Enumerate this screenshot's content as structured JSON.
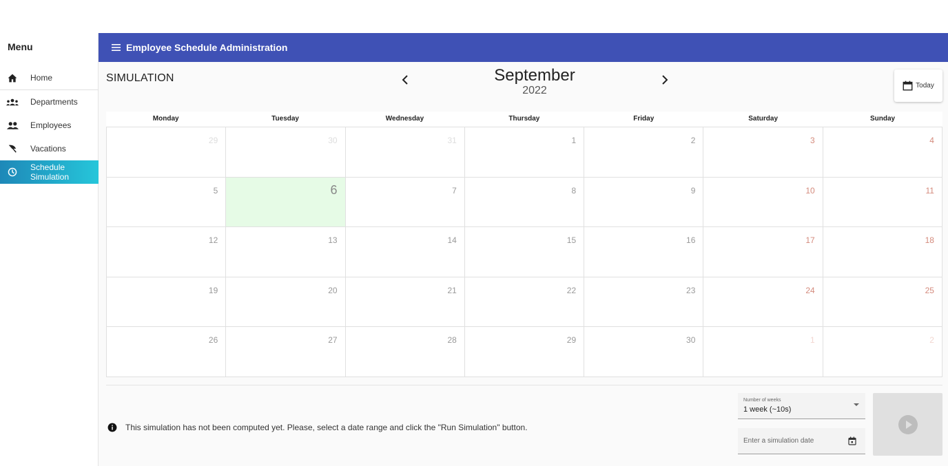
{
  "sidebar": {
    "title": "Menu",
    "items": [
      {
        "label": "Home",
        "icon": "home-icon"
      },
      {
        "label": "Departments",
        "icon": "groups-icon"
      },
      {
        "label": "Employees",
        "icon": "people-icon"
      },
      {
        "label": "Vacations",
        "icon": "beach-umbrella-icon"
      },
      {
        "label": "Schedule\nSimulation",
        "icon": "clock-icon",
        "active": true
      }
    ]
  },
  "header": {
    "title": "Employee Schedule Administration"
  },
  "main": {
    "section_label": "SIMULATION",
    "month": "September",
    "year": "2022",
    "today_label": "Today"
  },
  "calendar": {
    "weekdays": [
      "Monday",
      "Tuesday",
      "Wednesday",
      "Thursday",
      "Friday",
      "Saturday",
      "Sunday"
    ],
    "today": "6",
    "weeks": [
      [
        {
          "d": "29",
          "o": true
        },
        {
          "d": "30",
          "o": true
        },
        {
          "d": "31",
          "o": true
        },
        {
          "d": "1"
        },
        {
          "d": "2"
        },
        {
          "d": "3"
        },
        {
          "d": "4"
        }
      ],
      [
        {
          "d": "5"
        },
        {
          "d": "6",
          "t": true
        },
        {
          "d": "7"
        },
        {
          "d": "8"
        },
        {
          "d": "9"
        },
        {
          "d": "10"
        },
        {
          "d": "11"
        }
      ],
      [
        {
          "d": "12"
        },
        {
          "d": "13"
        },
        {
          "d": "14"
        },
        {
          "d": "15"
        },
        {
          "d": "16"
        },
        {
          "d": "17"
        },
        {
          "d": "18"
        }
      ],
      [
        {
          "d": "19"
        },
        {
          "d": "20"
        },
        {
          "d": "21"
        },
        {
          "d": "22"
        },
        {
          "d": "23"
        },
        {
          "d": "24"
        },
        {
          "d": "25"
        }
      ],
      [
        {
          "d": "26"
        },
        {
          "d": "27"
        },
        {
          "d": "28"
        },
        {
          "d": "29"
        },
        {
          "d": "30"
        },
        {
          "d": "1",
          "o": true
        },
        {
          "d": "2",
          "o": true
        }
      ]
    ]
  },
  "controls": {
    "info_text": "This simulation has not been computed yet. Please, select a date range and click the \"Run Simulation\" button.",
    "weeks_label": "Number of weeks",
    "weeks_value": "1 week (~10s)",
    "date_placeholder": "Enter a simulation date"
  },
  "colors": {
    "header_bg": "#3f51b5",
    "active_nav": "#26c6da",
    "today_cell": "#e6fbe6",
    "weekend_text": "#d48a7c"
  }
}
